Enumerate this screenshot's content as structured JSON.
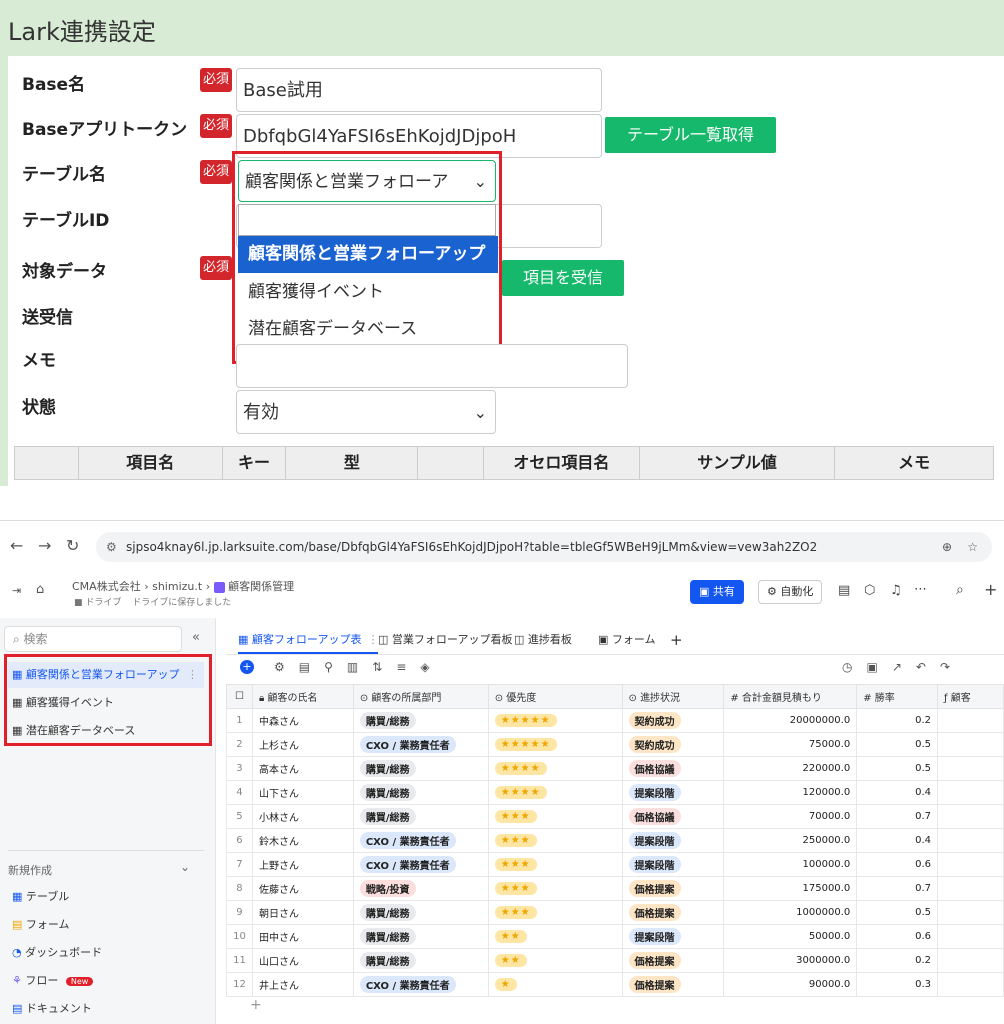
{
  "form": {
    "title": "Lark連携設定",
    "required_label": "必須",
    "labels": {
      "base_name": "Base名",
      "app_token": "Baseアプリトークン",
      "table_name": "テーブル名",
      "table_id": "テーブルID",
      "target_data": "対象データ",
      "send_receive": "送受信",
      "memo": "メモ",
      "status": "状態"
    },
    "values": {
      "base_name": "Base試用",
      "app_token": "DbfqbGl4YaFSI6sEhKojdJDjpoH",
      "table_name": "顧客関係と営業フォローア",
      "table_id": "",
      "memo": "",
      "status": "有効"
    },
    "buttons": {
      "get_tables": "テーブル一覧取得",
      "receive_fields": "項目を受信"
    },
    "dropdown_options": [
      "顧客関係と営業フォローアップ",
      "顧客獲得イベント",
      "潜在顧客データベース"
    ],
    "grid_headers": [
      "",
      "項目名",
      "キー",
      "型",
      "",
      "オセロ項目名",
      "サンプル値",
      "メモ"
    ]
  },
  "browser": {
    "url": "sjpso4knay6l.jp.larksuite.com/base/DbfqbGl4YaFSI6sEhKojdJDjpoH?table=tbleGf5WBeH9jLMm&view=vew3ah2ZO2"
  },
  "lark": {
    "breadcrumb": [
      "CMA株式会社",
      "shimizu.t",
      "顧客関係管理"
    ],
    "sub_breadcrumb": [
      "ドライブ",
      "ドライブに保存しました"
    ],
    "share_label": "共有",
    "automation_label": "自動化",
    "search_placeholder": "検索",
    "tables": [
      "顧客関係と営業フォローアップ",
      "顧客獲得イベント",
      "潜在顧客データベース"
    ],
    "create_new": "新規作成",
    "create_items": [
      "テーブル",
      "フォーム",
      "ダッシュボード",
      "フロー",
      "ドキュメント"
    ],
    "new_badge": "New",
    "tabs": [
      "顧客フォローアップ表",
      "営業フォローアップ看板",
      "進捗看板",
      "フォーム"
    ],
    "columns": [
      "顧客の氏名",
      "顧客の所属部門",
      "優先度",
      "進捗状況",
      "合計金額見積もり",
      "勝率",
      "顧客"
    ],
    "rows": [
      {
        "n": "1",
        "name": "中森さん",
        "dept": "購買/総務",
        "stars": 5,
        "status": "契約成功",
        "amount": "20000000.0",
        "rate": "0.2"
      },
      {
        "n": "2",
        "name": "上杉さん",
        "dept": "CXO / 業務責任者",
        "stars": 5,
        "status": "契約成功",
        "amount": "75000.0",
        "rate": "0.5"
      },
      {
        "n": "3",
        "name": "高本さん",
        "dept": "購買/総務",
        "stars": 4,
        "status": "価格協議",
        "amount": "220000.0",
        "rate": "0.5"
      },
      {
        "n": "4",
        "name": "山下さん",
        "dept": "購買/総務",
        "stars": 4,
        "status": "提案段階",
        "amount": "120000.0",
        "rate": "0.4"
      },
      {
        "n": "5",
        "name": "小林さん",
        "dept": "購買/総務",
        "stars": 3,
        "status": "価格協議",
        "amount": "70000.0",
        "rate": "0.7"
      },
      {
        "n": "6",
        "name": "鈴木さん",
        "dept": "CXO / 業務責任者",
        "stars": 3,
        "status": "提案段階",
        "amount": "250000.0",
        "rate": "0.4"
      },
      {
        "n": "7",
        "name": "上野さん",
        "dept": "CXO / 業務責任者",
        "stars": 3,
        "status": "提案段階",
        "amount": "100000.0",
        "rate": "0.6"
      },
      {
        "n": "8",
        "name": "佐藤さん",
        "dept": "戦略/投資",
        "stars": 3,
        "status": "価格提案",
        "amount": "175000.0",
        "rate": "0.7"
      },
      {
        "n": "9",
        "name": "朝日さん",
        "dept": "購買/総務",
        "stars": 3,
        "status": "価格提案",
        "amount": "1000000.0",
        "rate": "0.5"
      },
      {
        "n": "10",
        "name": "田中さん",
        "dept": "購買/総務",
        "stars": 2,
        "status": "提案段階",
        "amount": "50000.0",
        "rate": "0.6"
      },
      {
        "n": "11",
        "name": "山口さん",
        "dept": "購買/総務",
        "stars": 2,
        "status": "価格提案",
        "amount": "3000000.0",
        "rate": "0.2"
      },
      {
        "n": "12",
        "name": "井上さん",
        "dept": "CXO / 業務責任者",
        "stars": 1,
        "status": "価格提案",
        "amount": "90000.0",
        "rate": "0.3"
      }
    ],
    "colors": {
      "dept": {
        "購買/総務": "#e8eaed",
        "CXO / 業務責任者": "#dbe7fb",
        "戦略/投資": "#fbdede"
      },
      "status": {
        "契約成功": "#fde5c5",
        "価格協議": "#fbdede",
        "提案段階": "#dbe7fb",
        "価格提案": "#fde5c5"
      }
    }
  }
}
